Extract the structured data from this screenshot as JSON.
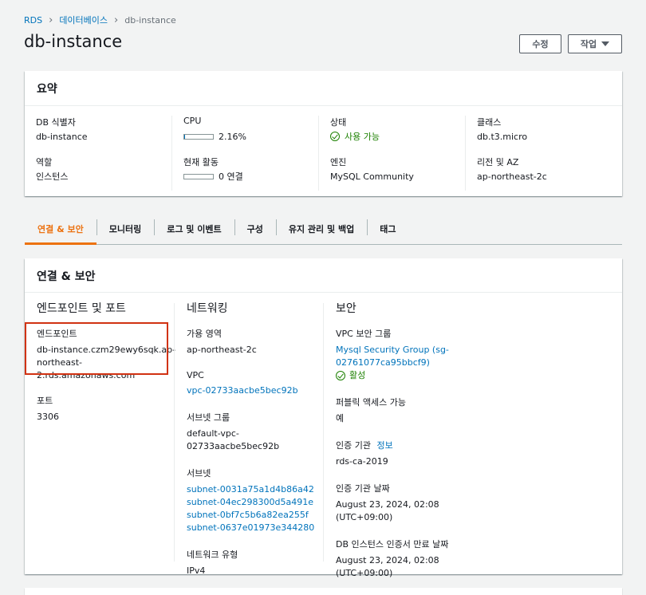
{
  "breadcrumb": {
    "item1": "RDS",
    "item2": "데이터베이스",
    "item3": "db-instance"
  },
  "title": "db-instance",
  "buttons": {
    "edit": "수정",
    "actions": "작업"
  },
  "summary": {
    "header": "요약",
    "identifier_label": "DB 식별자",
    "identifier_value": "db-instance",
    "role_label": "역할",
    "role_value": "인스턴스",
    "cpu_label": "CPU",
    "cpu_value": "2.16%",
    "cpu_fraction": 0.0216,
    "activity_label": "현재 활동",
    "activity_value": "0 연결",
    "activity_fraction": 0,
    "status_label": "상태",
    "status_value": "사용 가능",
    "engine_label": "엔진",
    "engine_value": "MySQL Community",
    "class_label": "클래스",
    "class_value": "db.t3.micro",
    "region_label": "리전 및 AZ",
    "region_value": "ap-northeast-2c"
  },
  "tabs": [
    "연결 & 보안",
    "모니터링",
    "로그 및 이벤트",
    "구성",
    "유지 관리 및 백업",
    "태그"
  ],
  "connectivity": {
    "header": "연결 & 보안",
    "endpoint_col": {
      "title": "엔드포인트 및 포트",
      "endpoint_label": "엔드포인트",
      "endpoint_line1": "db-instance.czm29ewy6sqk.ap-",
      "endpoint_line2": "northeast-2.rds.amazonaws.com",
      "port_label": "포트",
      "port_value": "3306"
    },
    "network_col": {
      "title": "네트워킹",
      "az_label": "가용 영역",
      "az_value": "ap-northeast-2c",
      "vpc_label": "VPC",
      "vpc_value": "vpc-02733aacbe5bec92b",
      "subnet_group_label": "서브넷 그룹",
      "subnet_group_line1": "default-vpc-",
      "subnet_group_line2": "02733aacbe5bec92b",
      "subnets_label": "서브넷",
      "subnets": [
        "subnet-0031a75a1d4b86a42",
        "subnet-04ec298300d5a491e",
        "subnet-0bf7c5b6a82ea255f",
        "subnet-0637e01973e344280"
      ],
      "network_type_label": "네트워크 유형",
      "network_type_value": "IPv4"
    },
    "security_col": {
      "title": "보안",
      "sg_label": "VPC 보안 그룹",
      "sg_line1": "Mysql Security Group (sg-",
      "sg_line2": "02761077ca95bbcf9)",
      "sg_status": "활성",
      "public_label": "퍼블릭 액세스 가능",
      "public_value": "예",
      "ca_label": "인증 기관",
      "ca_info": "정보",
      "ca_value": "rds-ca-2019",
      "ca_date_label": "인증 기관 날짜",
      "ca_date_line1": "August 23, 2024, 02:08",
      "ca_date_line2": "(UTC+09:00)",
      "cert_expiry_label": "DB 인스턴스 인증서 만료 날짜",
      "cert_expiry_line1": "August 23, 2024, 02:08",
      "cert_expiry_line2": "(UTC+09:00)"
    }
  },
  "colors": {
    "accent": "#ec7211",
    "link": "#0073bb",
    "success": "#1d8102",
    "highlight": "#d13212"
  }
}
